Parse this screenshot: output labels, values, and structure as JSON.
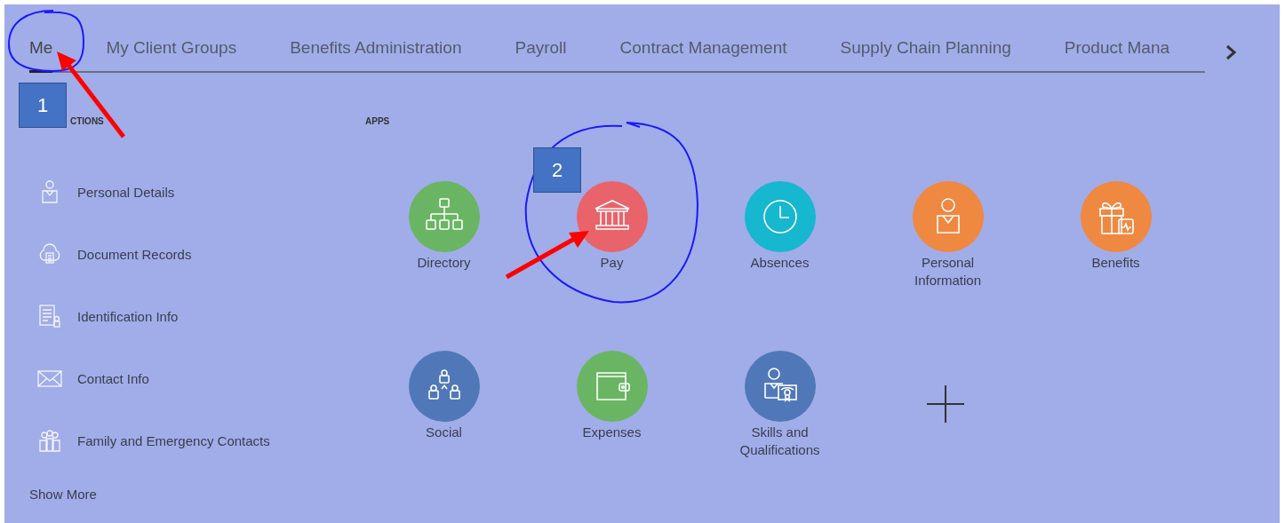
{
  "tabs": [
    {
      "label": "Me",
      "selected": true
    },
    {
      "label": "My Client Groups",
      "selected": false
    },
    {
      "label": "Benefits Administration",
      "selected": false
    },
    {
      "label": "Payroll",
      "selected": false
    },
    {
      "label": "Contract Management",
      "selected": false
    },
    {
      "label": "Supply Chain Planning",
      "selected": false
    },
    {
      "label": "Product Mana",
      "selected": false
    }
  ],
  "quick_actions": {
    "heading": "CTIONS",
    "items": [
      {
        "label": "Personal Details"
      },
      {
        "label": "Document Records"
      },
      {
        "label": "Identification Info"
      },
      {
        "label": "Contact Info"
      },
      {
        "label": "Family and Emergency Contacts"
      }
    ],
    "show_more": "Show More"
  },
  "apps": {
    "heading": "APPS",
    "items": [
      {
        "label": "Directory",
        "color": "#6ab563"
      },
      {
        "label": "Pay",
        "color": "#e9636a"
      },
      {
        "label": "Absences",
        "color": "#16b7cf"
      },
      {
        "label": "Personal Information",
        "color": "#ef8841"
      },
      {
        "label": "Benefits",
        "color": "#ef8841"
      },
      {
        "label": "Social",
        "color": "#5078b9"
      },
      {
        "label": "Expenses",
        "color": "#6ab563"
      },
      {
        "label": "Skills and Qualifications",
        "color": "#5078b9"
      }
    ]
  },
  "annotations": [
    {
      "text": "1"
    },
    {
      "text": "2"
    }
  ]
}
